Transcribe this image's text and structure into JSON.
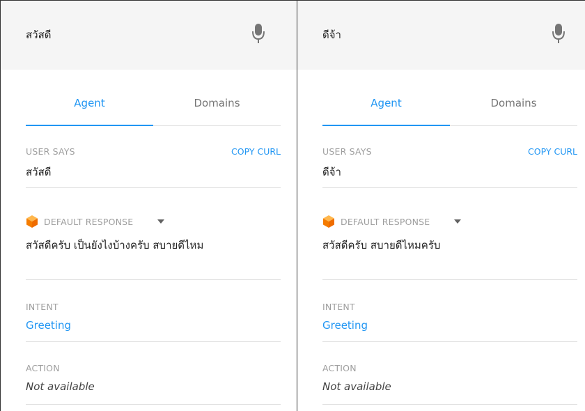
{
  "panels": [
    {
      "query": "สวัสดี",
      "tabs": [
        "Agent",
        "Domains"
      ],
      "user_says": {
        "label": "USER SAYS",
        "copy": "COPY CURL",
        "text": "สวัสดี"
      },
      "response": {
        "label": "DEFAULT RESPONSE",
        "text": "สวัสดีครับ เป็นยังไงบ้างครับ สบายดีไหม"
      },
      "intent": {
        "label": "INTENT",
        "value": "Greeting"
      },
      "action": {
        "label": "ACTION",
        "value": "Not available"
      }
    },
    {
      "query": "ดีจ้า",
      "tabs": [
        "Agent",
        "Domains"
      ],
      "user_says": {
        "label": "USER SAYS",
        "copy": "COPY CURL",
        "text": "ดีจ้า"
      },
      "response": {
        "label": "DEFAULT RESPONSE",
        "text": "สวัสดีครับ สบายดีไหมครับ"
      },
      "intent": {
        "label": "INTENT",
        "value": "Greeting"
      },
      "action": {
        "label": "ACTION",
        "value": "Not available"
      }
    }
  ],
  "icons": {
    "microphone": "mic-icon",
    "dropdown": "caret-down-icon",
    "response_badge": "orange-cube-icon"
  },
  "colors": {
    "accent": "#2196f3",
    "label": "#9e9e9e",
    "query_bar": "#f5f5f5",
    "divider": "#e0e0e0",
    "cube": "#ff9800"
  }
}
